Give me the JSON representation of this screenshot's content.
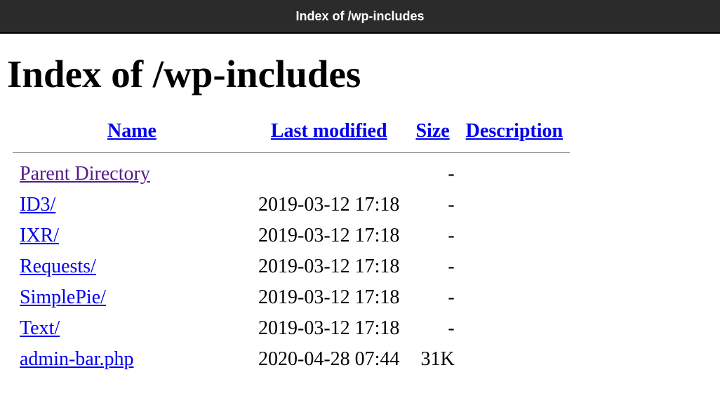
{
  "browser": {
    "tab_title": "Index of /wp-includes"
  },
  "page": {
    "heading": "Index of /wp-includes"
  },
  "columns": {
    "name": "Name",
    "last_modified": "Last modified",
    "size": "Size",
    "description": "Description"
  },
  "rows": [
    {
      "name": "Parent Directory",
      "last_modified": "",
      "size": "-",
      "description": "",
      "visited": true
    },
    {
      "name": "ID3/",
      "last_modified": "2019-03-12 17:18",
      "size": "-",
      "description": "",
      "visited": false
    },
    {
      "name": "IXR/",
      "last_modified": "2019-03-12 17:18",
      "size": "-",
      "description": "",
      "visited": false
    },
    {
      "name": "Requests/",
      "last_modified": "2019-03-12 17:18",
      "size": "-",
      "description": "",
      "visited": false
    },
    {
      "name": "SimplePie/",
      "last_modified": "2019-03-12 17:18",
      "size": "-",
      "description": "",
      "visited": false
    },
    {
      "name": "Text/",
      "last_modified": "2019-03-12 17:18",
      "size": "-",
      "description": "",
      "visited": false
    },
    {
      "name": "admin-bar.php",
      "last_modified": "2020-04-28 07:44",
      "size": "31K",
      "description": "",
      "visited": false
    }
  ]
}
